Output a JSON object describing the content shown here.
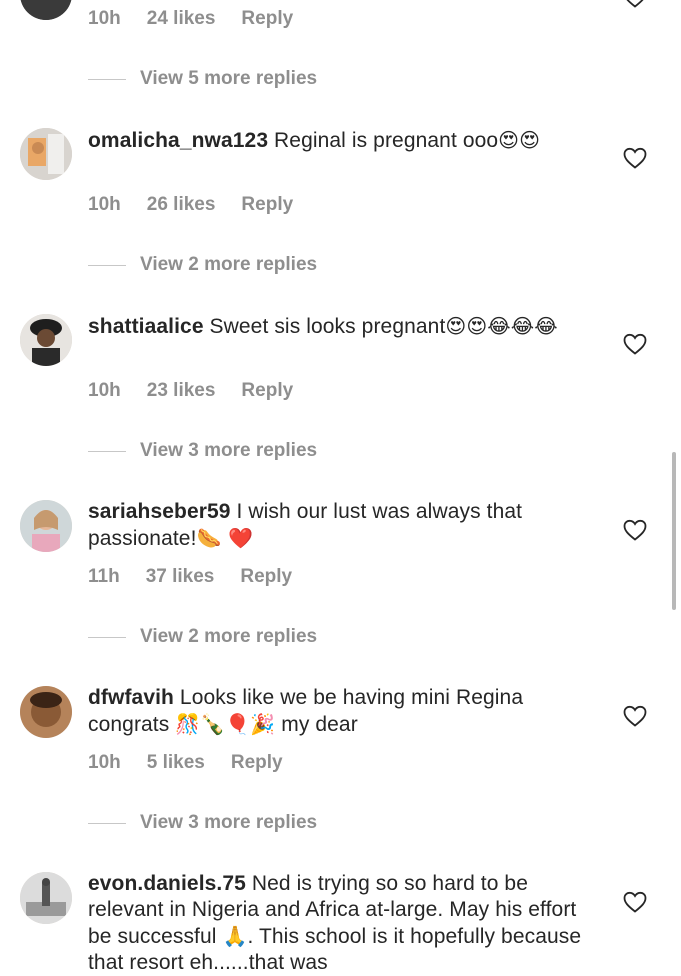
{
  "top": {
    "time": "10h",
    "likes": "24 likes",
    "reply": "Reply",
    "view_replies": "View 5 more replies"
  },
  "comments": [
    {
      "username": "omalicha_nwa123",
      "text": " Reginal is pregnant ooo",
      "emoji": "😍😍",
      "time": "10h",
      "likes": "26 likes",
      "reply": "Reply",
      "view_replies": "View 2 more replies"
    },
    {
      "username": "shattiaalice",
      "text": " Sweet sis looks pregnant",
      "emoji": "😍😍😂😂😂",
      "time": "10h",
      "likes": "23 likes",
      "reply": "Reply",
      "view_replies": "View 3 more replies"
    },
    {
      "username": "sariahseber59",
      "text": " I wish our lust was always that passionate!",
      "emoji": "🌭 ❤️",
      "time": "11h",
      "likes": "37 likes",
      "reply": "Reply",
      "view_replies": "View 2 more replies"
    },
    {
      "username": "dfwfavih",
      "text": " Looks like we be having mini Regina congrats",
      "emoji": "🎊🍾🎈🎉",
      "text_after": " my dear",
      "time": "10h",
      "likes": "5 likes",
      "reply": "Reply",
      "view_replies": "View 3 more replies"
    },
    {
      "username": "evon.daniels.75",
      "text": " Ned is trying so so hard to be relevant in Nigeria and Africa at-large.  May his effort be successful ",
      "emoji": "🙏",
      "text_after": ". This school is it hopefully because that resort eh......that was"
    }
  ],
  "icons": {
    "heart": "heart-outline-icon",
    "avatar": "avatar"
  },
  "colors": {
    "text": "#262626",
    "meta": "#8e8e8e",
    "background": "#ffffff"
  }
}
